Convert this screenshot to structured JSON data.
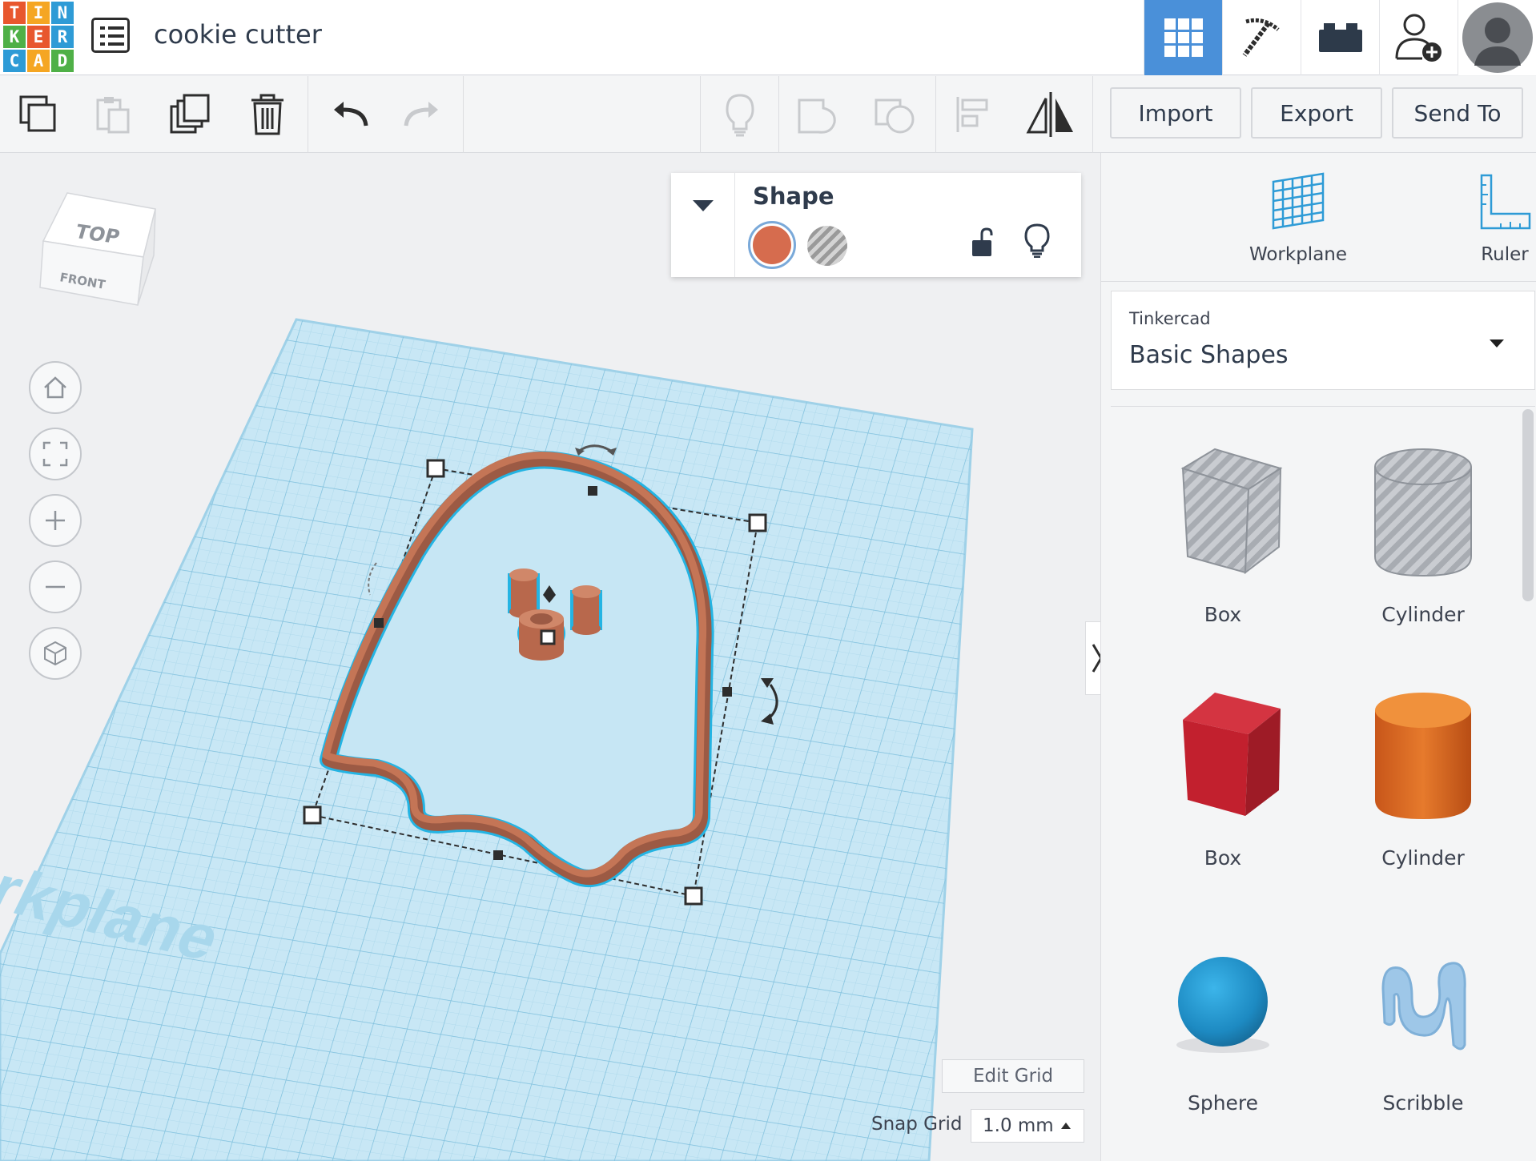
{
  "app": {
    "logo_letters": [
      "T",
      "I",
      "N",
      "K",
      "E",
      "R",
      "C",
      "A",
      "D"
    ],
    "logo_colors": [
      "#e8572e",
      "#f5a623",
      "#2e9bd6",
      "#4fb047",
      "#e8572e",
      "#2e9bd6",
      "#2e9bd6",
      "#f5a623",
      "#4fb047"
    ],
    "document_title": "cookie cutter"
  },
  "top_nav": {
    "items": [
      {
        "icon": "grid-view-icon",
        "active": true
      },
      {
        "icon": "pickaxe-icon",
        "active": false
      },
      {
        "icon": "brick-icon",
        "active": false
      },
      {
        "icon": "add-user-icon",
        "active": false
      }
    ],
    "avatar_icon": "user-avatar-icon",
    "accent_color": "#4a90d9"
  },
  "toolbar": {
    "left_tools": [
      "copy-icon",
      "paste-icon",
      "duplicate-icon",
      "delete-icon",
      "undo-icon",
      "redo-icon"
    ],
    "right_tools": [
      "show-all-icon",
      "group-icon",
      "ungroup-icon",
      "align-icon",
      "mirror-icon"
    ],
    "import_label": "Import",
    "export_label": "Export",
    "send_to_label": "Send To"
  },
  "canvas": {
    "view_cube": {
      "top_label": "TOP",
      "front_label": "FRONT"
    },
    "workplane_watermark": "Workplane",
    "edit_grid_label": "Edit Grid",
    "snap_grid_label": "Snap Grid",
    "snap_grid_value": "1.0 mm",
    "shape_color": "#c47556",
    "grid_color": "#bfe3f3"
  },
  "inspector": {
    "title": "Shape",
    "solid_color": "#d66c4e"
  },
  "right_panel": {
    "workplane_label": "Workplane",
    "ruler_label": "Ruler",
    "library_provider": "Tinkercad",
    "library_name": "Basic Shapes",
    "shapes": [
      {
        "label": "Box",
        "kind": "box-hole"
      },
      {
        "label": "Cylinder",
        "kind": "cylinder-hole"
      },
      {
        "label": "Box",
        "kind": "box-red"
      },
      {
        "label": "Cylinder",
        "kind": "cylinder-orange"
      },
      {
        "label": "Sphere",
        "kind": "sphere-blue"
      },
      {
        "label": "Scribble",
        "kind": "scribble"
      }
    ]
  }
}
